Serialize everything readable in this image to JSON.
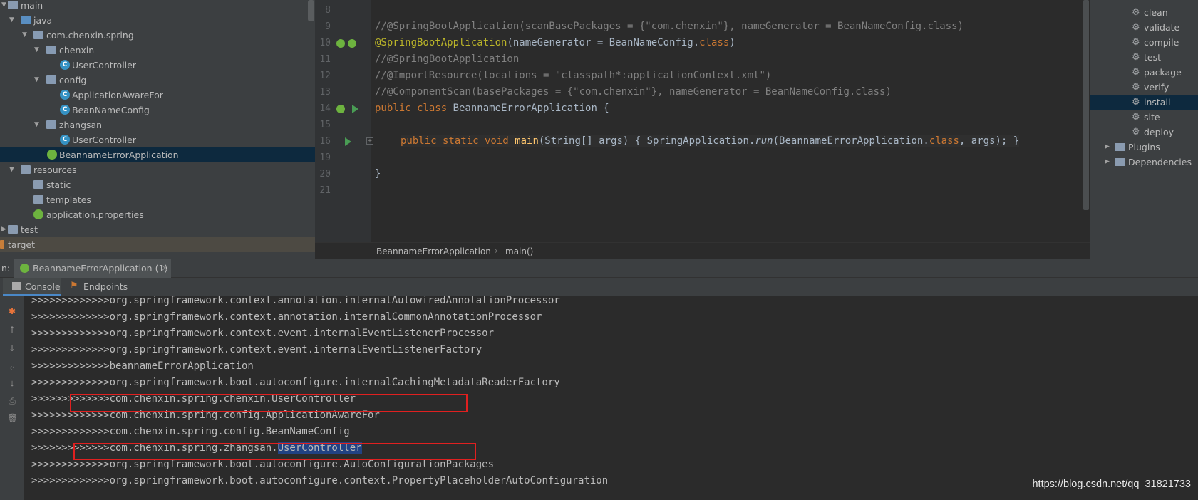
{
  "project_tree": {
    "items": [
      {
        "label": "main",
        "type": "folder"
      },
      {
        "label": "java",
        "type": "folder-blue"
      },
      {
        "label": "com.chenxin.spring",
        "type": "package"
      },
      {
        "label": "chenxin",
        "type": "package"
      },
      {
        "label": "UserController",
        "type": "class"
      },
      {
        "label": "config",
        "type": "package"
      },
      {
        "label": "ApplicationAwareFor",
        "type": "class"
      },
      {
        "label": "BeanNameConfig",
        "type": "class"
      },
      {
        "label": "zhangsan",
        "type": "package"
      },
      {
        "label": "UserController",
        "type": "class"
      },
      {
        "label": "BeannameErrorApplication",
        "type": "spring-class"
      },
      {
        "label": "resources",
        "type": "folder"
      },
      {
        "label": "static",
        "type": "folder"
      },
      {
        "label": "templates",
        "type": "folder"
      },
      {
        "label": "application.properties",
        "type": "properties"
      },
      {
        "label": "test",
        "type": "folder"
      },
      {
        "label": "target",
        "type": "folder-orange"
      }
    ]
  },
  "editor": {
    "lines": [
      {
        "num": "8"
      },
      {
        "num": "9",
        "text": "//@SpringBootApplication(scanBasePackages = {\"com.chenxin\"}, nameGenerator = BeanNameConfig.class)"
      },
      {
        "num": "10",
        "anno": "@SpringBootApplication",
        "text": "(nameGenerator = BeanNameConfig.",
        "kw": "class",
        "tail": ")"
      },
      {
        "num": "11",
        "text": "//@SpringBootApplication"
      },
      {
        "num": "12",
        "text": "//@ImportResource(locations = \"classpath*:applicationContext.xml\")"
      },
      {
        "num": "13",
        "text": "//@ComponentScan(basePackages = {\"com.chenxin\"}, nameGenerator = BeanNameConfig.class)"
      },
      {
        "num": "14",
        "kw": "public class ",
        "text": "BeannameErrorApplication {"
      },
      {
        "num": "15"
      },
      {
        "num": "16",
        "kw": "public static void ",
        "fn": "main",
        "text": "(String[] args) { SpringApplication.",
        "italic": "run",
        "tail": "(BeannameErrorApplication.",
        "kw2": "class",
        "tail2": ", args); }"
      },
      {
        "num": "19"
      },
      {
        "num": "20",
        "text": "}"
      },
      {
        "num": "21"
      }
    ],
    "breadcrumb": [
      "BeannameErrorApplication",
      "main()"
    ]
  },
  "maven": {
    "items": [
      "clean",
      "validate",
      "compile",
      "test",
      "package",
      "verify",
      "install",
      "site",
      "deploy"
    ],
    "groups": [
      "Plugins",
      "Dependencies"
    ],
    "selected": "install"
  },
  "run_panel": {
    "prefix": "n:",
    "tab": "BeannameErrorApplication (1)",
    "close": "×",
    "console_tab": "Console",
    "endpoints_tab": "Endpoints"
  },
  "console": {
    "lines": [
      ">>>>>>>>>>>>>org.springframework.context.annotation.internalAutowiredAnnotationProcessor",
      ">>>>>>>>>>>>>org.springframework.context.annotation.internalCommonAnnotationProcessor",
      ">>>>>>>>>>>>>org.springframework.context.event.internalEventListenerProcessor",
      ">>>>>>>>>>>>>org.springframework.context.event.internalEventListenerFactory",
      ">>>>>>>>>>>>>beannameErrorApplication",
      ">>>>>>>>>>>>>org.springframework.boot.autoconfigure.internalCachingMetadataReaderFactory",
      ">>>>>>>>>>>>>com.chenxin.spring.chenxin.UserController",
      ">>>>>>>>>>>>>com.chenxin.spring.config.ApplicationAwareFor",
      ">>>>>>>>>>>>>com.chenxin.spring.config.BeanNameConfig",
      ">>>>>>>>>>>>>com.chenxin.spring.zhangsan.",
      ">>>>>>>>>>>>>org.springframework.boot.autoconfigure.AutoConfigurationPackages",
      ">>>>>>>>>>>>>org.springframework.boot.autoconfigure.context.PropertyPlaceholderAutoConfiguration"
    ],
    "highlight": "UserController"
  },
  "watermark": "https://blog.csdn.net/qq_31821733"
}
